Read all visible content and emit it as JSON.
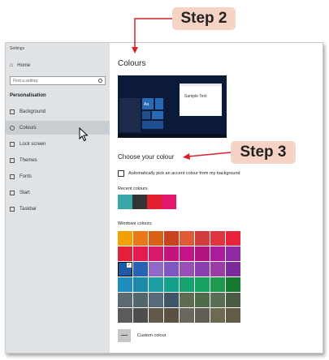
{
  "sidebar": {
    "app_title": "Settings",
    "home_label": "Home",
    "search_placeholder": "Find a setting",
    "section_heading": "Personalisation",
    "items": [
      {
        "label": "Background",
        "icon": "picture-icon"
      },
      {
        "label": "Colours",
        "icon": "palette-icon",
        "active": true
      },
      {
        "label": "Lock screen",
        "icon": "lock-screen-icon"
      },
      {
        "label": "Themes",
        "icon": "brush-icon"
      },
      {
        "label": "Fonts",
        "icon": "font-icon"
      },
      {
        "label": "Start",
        "icon": "start-icon"
      },
      {
        "label": "Taskbar",
        "icon": "taskbar-icon"
      }
    ]
  },
  "main": {
    "title": "Colours",
    "preview_sample_text": "Sample Text",
    "preview_tile_text": "Aa",
    "subtitle": "Choose your colour",
    "auto_pick_label": "Automatically pick an accent colour from my background",
    "recent_label": "Recent colours",
    "recent_colours": [
      "#3aa6a8",
      "#333333",
      "#e0202f",
      "#e2186e"
    ],
    "windows_label": "Windows colours",
    "windows_colours": [
      [
        "#f4a000",
        "#e9781b",
        "#d96116",
        "#c8421f",
        "#e15a37",
        "#d33c3c",
        "#e1343f",
        "#e8233b"
      ],
      [
        "#e6203a",
        "#e11d50",
        "#d6186f",
        "#c3147c",
        "#c5148a",
        "#b3157f",
        "#ac1a9e",
        "#8e2aa1"
      ],
      [
        "#1f5aa6",
        "#2762b5",
        "#8f68c9",
        "#7d56c2",
        "#9a4fb8",
        "#8b3fae",
        "#9c3aa6",
        "#7c2a9c"
      ],
      [
        "#1d8fbf",
        "#1a8aa6",
        "#1aa0a2",
        "#16a087",
        "#15a46f",
        "#16a360",
        "#1d9a4b",
        "#187a32"
      ],
      [
        "#5a6a70",
        "#52666b",
        "#566a7a",
        "#3f5568",
        "#5e6c4f",
        "#4f6b48",
        "#5a6e55",
        "#4a5c45"
      ],
      [
        "#5b5b5b",
        "#4e4e4e",
        "#62594b",
        "#5a5142",
        "#6a675e",
        "#625e55",
        "#6e6a50",
        "#605c45"
      ]
    ],
    "selected_colour": [
      2,
      0
    ],
    "custom_label": "Custom colour"
  },
  "annotations": {
    "step2": "Step 2",
    "step3": "Step 3",
    "arrow_color": "#d8202a"
  }
}
